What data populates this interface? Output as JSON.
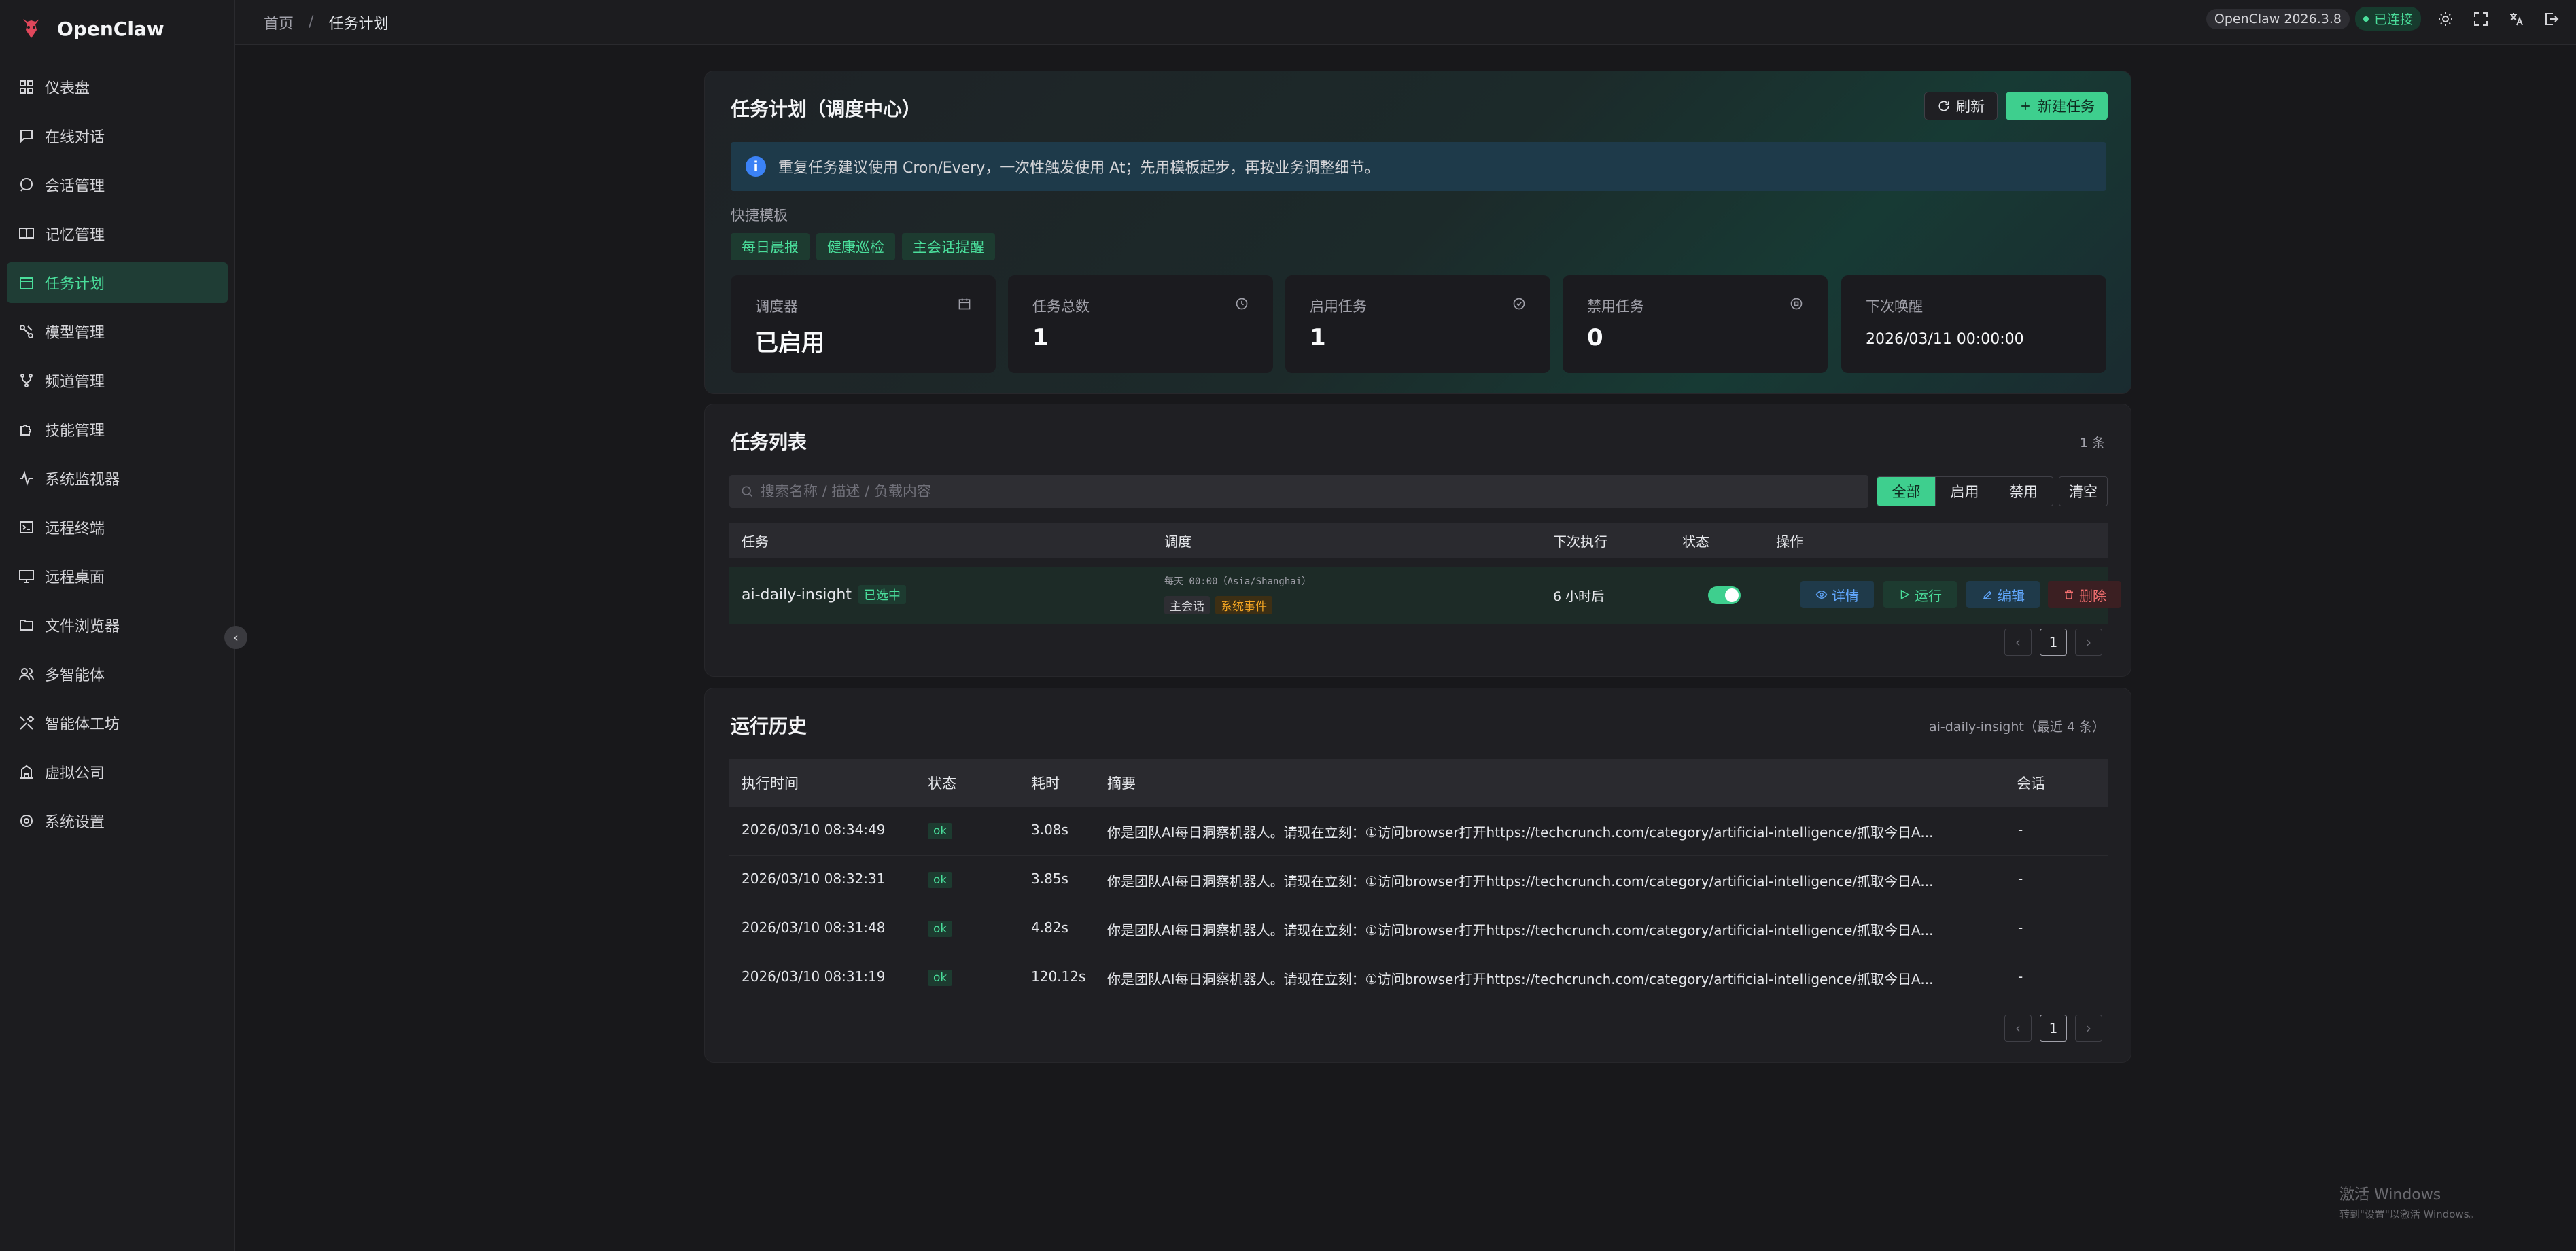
{
  "app": {
    "name": "OpenClaw"
  },
  "sidebar": {
    "items": [
      {
        "label": "仪表盘",
        "icon": "grid-icon"
      },
      {
        "label": "在线对话",
        "icon": "chat-icon"
      },
      {
        "label": "会话管理",
        "icon": "bubble-icon"
      },
      {
        "label": "记忆管理",
        "icon": "book-icon"
      },
      {
        "label": "任务计划",
        "icon": "calendar-icon"
      },
      {
        "label": "模型管理",
        "icon": "model-icon"
      },
      {
        "label": "频道管理",
        "icon": "branch-icon"
      },
      {
        "label": "技能管理",
        "icon": "puzzle-icon"
      },
      {
        "label": "系统监视器",
        "icon": "pulse-icon"
      },
      {
        "label": "远程终端",
        "icon": "terminal-icon"
      },
      {
        "label": "远程桌面",
        "icon": "monitor-icon"
      },
      {
        "label": "文件浏览器",
        "icon": "folder-icon"
      },
      {
        "label": "多智能体",
        "icon": "users-icon"
      },
      {
        "label": "智能体工坊",
        "icon": "tools-icon"
      },
      {
        "label": "虚拟公司",
        "icon": "building-icon"
      },
      {
        "label": "系统设置",
        "icon": "gear-icon"
      }
    ],
    "active_index": 4
  },
  "topbar": {
    "breadcrumb_home": "首页",
    "breadcrumb_sep": "/",
    "breadcrumb_current": "任务计划",
    "version": "OpenClaw 2026.3.8",
    "status": "已连接"
  },
  "overview": {
    "title": "任务计划（调度中心）",
    "refresh_label": "刷新",
    "new_task_label": "新建任务",
    "info_text": "重复任务建议使用 Cron/Every，一次性触发使用 At；先用模板起步，再按业务调整细节。",
    "templates_label": "快捷模板",
    "templates": [
      "每日晨报",
      "健康巡检",
      "主会话提醒"
    ],
    "stats": [
      {
        "label": "调度器",
        "value": "已启用",
        "icon": "calendar-icon"
      },
      {
        "label": "任务总数",
        "value": "1",
        "icon": "clock-icon"
      },
      {
        "label": "启用任务",
        "value": "1",
        "icon": "check-circle-icon"
      },
      {
        "label": "禁用任务",
        "value": "0",
        "icon": "stop-circle-icon"
      },
      {
        "label": "下次唤醒",
        "value": "2026/03/11 00:00:00",
        "icon": ""
      }
    ]
  },
  "task_list": {
    "title": "任务列表",
    "count": "1 条",
    "search_placeholder": "搜索名称 / 描述 / 负载内容",
    "filters": [
      "全部",
      "启用",
      "禁用"
    ],
    "clear_label": "清空",
    "columns": [
      "任务",
      "调度",
      "下次执行",
      "状态",
      "操作"
    ],
    "rows": [
      {
        "name": "ai-daily-insight",
        "selected_tag": "已选中",
        "schedule": "每天 00:00（Asia/Shanghai）",
        "tag_session": "主会话",
        "tag_event": "系统事件",
        "next_run": "6 小时后",
        "enabled": true,
        "actions": [
          "详情",
          "运行",
          "编辑",
          "删除"
        ]
      }
    ],
    "page": "1"
  },
  "history": {
    "title": "运行历史",
    "subtitle": "ai-daily-insight（最近 4 条）",
    "columns": [
      "执行时间",
      "状态",
      "耗时",
      "摘要",
      "会话"
    ],
    "rows": [
      {
        "time": "2026/03/10 08:34:49",
        "status": "ok",
        "duration": "3.08s",
        "summary": "你是团队AI每日洞察机器人。请现在立刻：①访问browser打开https://techcrunch.com/category/artificial-intelligence/抓取今日A...",
        "session": "-"
      },
      {
        "time": "2026/03/10 08:32:31",
        "status": "ok",
        "duration": "3.85s",
        "summary": "你是团队AI每日洞察机器人。请现在立刻：①访问browser打开https://techcrunch.com/category/artificial-intelligence/抓取今日A...",
        "session": "-"
      },
      {
        "time": "2026/03/10 08:31:48",
        "status": "ok",
        "duration": "4.82s",
        "summary": "你是团队AI每日洞察机器人。请现在立刻：①访问browser打开https://techcrunch.com/category/artificial-intelligence/抓取今日A...",
        "session": "-"
      },
      {
        "time": "2026/03/10 08:31:19",
        "status": "ok",
        "duration": "120.12s",
        "summary": "你是团队AI每日洞察机器人。请现在立刻：①访问browser打开https://techcrunch.com/category/artificial-intelligence/抓取今日A...",
        "session": "-"
      }
    ],
    "page": "1"
  },
  "watermark": {
    "line1": "激活 Windows",
    "line2": "转到\"设置\"以激活 Windows。"
  },
  "colors": {
    "accent": "#3ecf8e",
    "background": "#18181b",
    "sidebar": "#1c1c1f"
  }
}
